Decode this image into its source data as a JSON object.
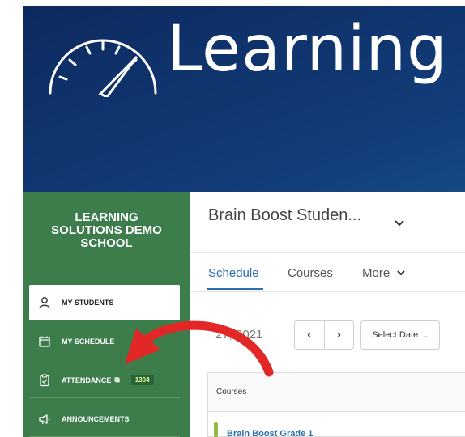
{
  "brand": {
    "logo_text": "Learning"
  },
  "sidebar": {
    "school_name": [
      "LEARNING",
      "SOLUTIONS DEMO",
      "SCHOOL"
    ],
    "items": [
      {
        "label": "MY STUDENTS",
        "icon": "person-icon",
        "active": true
      },
      {
        "label": "MY SCHEDULE",
        "icon": "calendar-icon",
        "active": false
      },
      {
        "label": "ATTENDANCE",
        "icon": "clipboard-check-icon",
        "active": false,
        "badge": "1304"
      },
      {
        "label": "ANNOUNCEMENTS",
        "icon": "megaphone-icon",
        "active": false
      }
    ]
  },
  "header": {
    "title": "Brain Boost Studen..."
  },
  "tabs": [
    {
      "label": "Schedule",
      "active": true
    },
    {
      "label": "Courses",
      "active": false
    },
    {
      "label": "More",
      "active": false
    }
  ],
  "date_bar": {
    "date_text": "27, 2021",
    "select_label": "Select Date"
  },
  "table": {
    "column_header": "Courses",
    "first_course": "Brain Boost Grade 1"
  },
  "colors": {
    "sidebar": "#3d7d4b",
    "accent": "#2a6fb0",
    "arrow": "#e32626"
  }
}
